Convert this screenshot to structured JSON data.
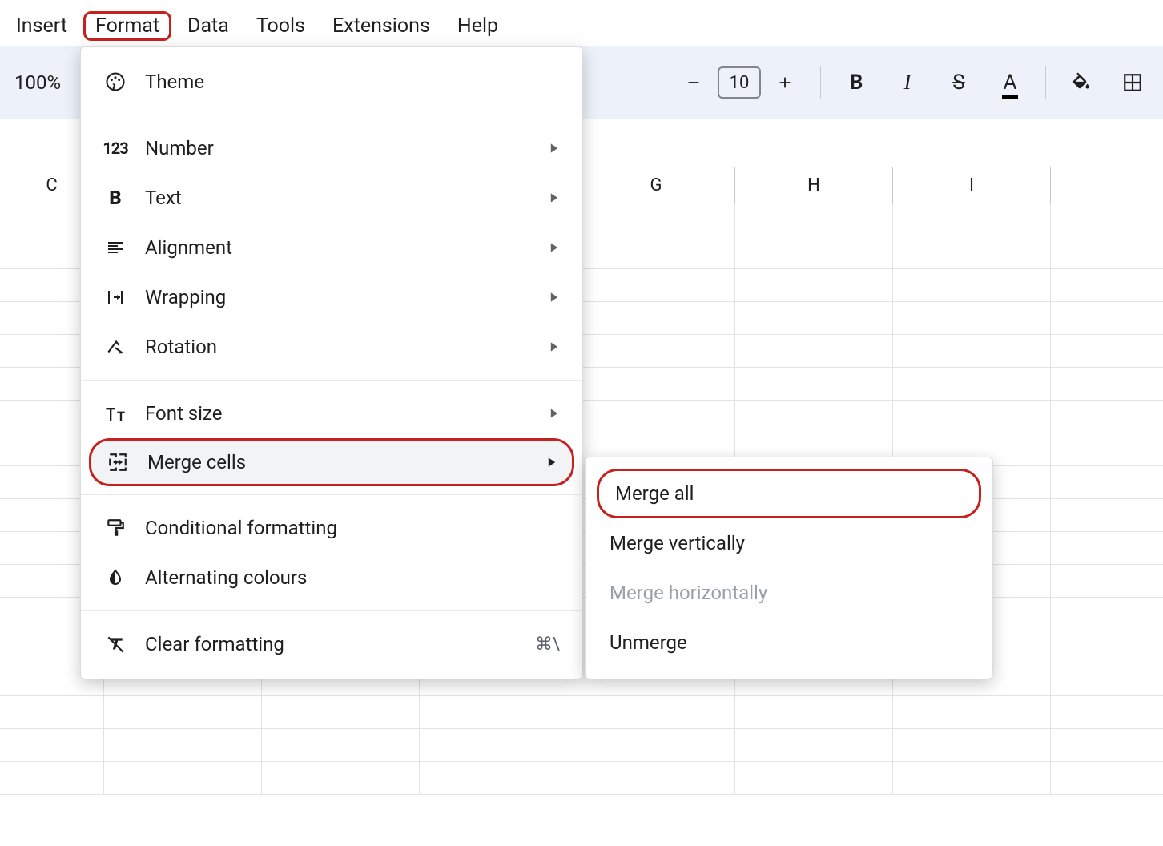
{
  "menubar": [
    "Insert",
    "Format",
    "Data",
    "Tools",
    "Extensions",
    "Help"
  ],
  "menubar_active_index": 1,
  "toolbar": {
    "zoom": "100%",
    "font_size": "10"
  },
  "columns": [
    "C",
    "",
    "",
    "",
    "G",
    "H",
    "I"
  ],
  "format_menu": {
    "theme": "Theme",
    "number": "Number",
    "text": "Text",
    "alignment": "Alignment",
    "wrapping": "Wrapping",
    "rotation": "Rotation",
    "font_size": "Font size",
    "merge_cells": "Merge cells",
    "conditional": "Conditional formatting",
    "alternating": "Alternating colours",
    "clear": "Clear formatting",
    "clear_shortcut": "⌘\\"
  },
  "merge_submenu": {
    "all": "Merge all",
    "vertically": "Merge vertically",
    "horizontally": "Merge horizontally",
    "unmerge": "Unmerge"
  }
}
